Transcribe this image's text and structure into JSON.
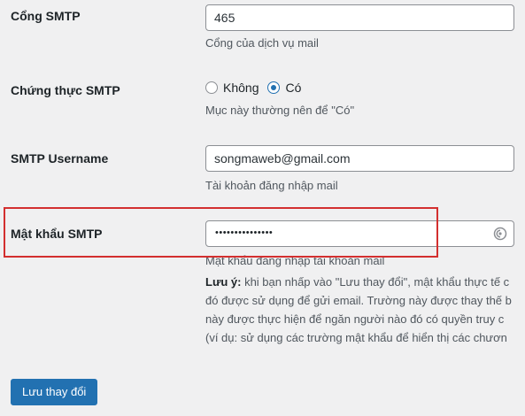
{
  "settings": {
    "smtp_port": {
      "label": "Cổng SMTP",
      "value": "465",
      "description": "Cổng của dịch vụ mail"
    },
    "smtp_auth": {
      "label": "Chứng thực SMTP",
      "options": [
        {
          "label": "Không",
          "checked": false
        },
        {
          "label": "Có",
          "checked": true
        }
      ],
      "description": "Mục này thường nên để \"Có\""
    },
    "smtp_username": {
      "label": "SMTP Username",
      "value": "songmaweb@gmail.com",
      "description": "Tài khoản đăng nhập mail"
    },
    "smtp_password": {
      "label": "Mật khẩu SMTP",
      "masked_value": "•••••••••••••••",
      "reveal_icon": "eye-icon",
      "description": "Mật khẩu đăng nhập tài khoản mail"
    },
    "note": {
      "strong": "Lưu ý:",
      "line1_rest": " khi bạn nhấp vào \"Lưu thay đổi\", mật khẩu thực tế c",
      "line2": "đó được sử dụng để gửi email. Trường này được thay thế b",
      "line3": "này được thực hiện để ngăn người nào đó có quyền truy c",
      "line4": "(ví dụ: sử dụng các trường mật khẩu để hiển thị các chươn"
    }
  },
  "actions": {
    "save_label": "Lưu thay đổi"
  },
  "colors": {
    "background": "#f0f0f1",
    "accent": "#2271b1",
    "highlight_border": "#d32f2f"
  }
}
